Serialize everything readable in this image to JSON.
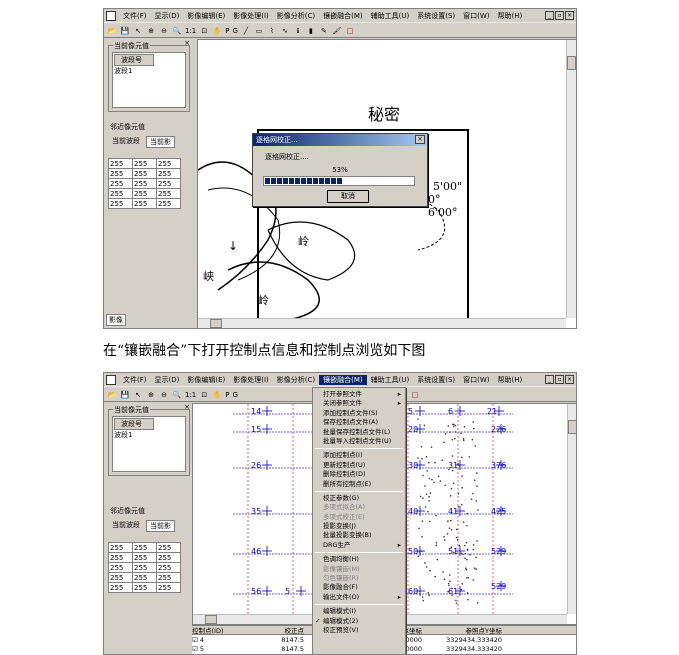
{
  "screenshot1": {
    "menu": [
      "文件(F)",
      "显示(D)",
      "影像编辑(E)",
      "影像处理(I)",
      "影像分析(C)",
      "镶嵌融合(M)",
      "辅助工具(U)",
      "系统设置(S)",
      "窗口(W)",
      "帮助(H)"
    ],
    "toolbar_text": [
      "1:1",
      "P",
      "G"
    ],
    "panel": {
      "group1_title": "当前像元值",
      "list_header": "波段号",
      "list_items": [
        "波段1"
      ],
      "group2_title": "邻近像元值",
      "tab_label1": "当前波段",
      "tab_label2": "当前影",
      "grid": [
        [
          "255",
          "255",
          "255"
        ],
        [
          "255",
          "255",
          "255"
        ],
        [
          "255",
          "255",
          "255"
        ],
        [
          "255",
          "255",
          "255"
        ],
        [
          "255",
          "255",
          "255"
        ]
      ]
    },
    "map": {
      "secret_label": "秘密",
      "coord_text": [
        "5'00\"",
        "0°",
        "6'00°"
      ],
      "place_labels": [
        "峡",
        "岭",
        "岭",
        "↓"
      ]
    },
    "dialog": {
      "title": "逐格网校正...",
      "close": "×",
      "message": "逐格网校正....",
      "percent_text": "53%",
      "progress": 53,
      "cancel": "取消"
    },
    "status_tab": "影像"
  },
  "caption": "在“镶嵌融合”下打开控制点信息和控制点浏览如下图",
  "screenshot2": {
    "menu": [
      "文件(F)",
      "显示(D)",
      "影像编辑(E)",
      "影像处理(I)",
      "影像分析(C)",
      "镶嵌融合(M)",
      "辅助工具(U)",
      "系统设置(S)",
      "窗口(W)",
      "帮助(H)"
    ],
    "panel": {
      "group1_title": "当前像元值",
      "list_header": "波段号",
      "list_items": [
        "波段1"
      ],
      "group2_title": "邻近像元值",
      "tab_label1": "当前波段",
      "tab_label2": "当前影",
      "grid": [
        [
          "255",
          "255",
          "255"
        ],
        [
          "255",
          "255",
          "255"
        ],
        [
          "255",
          "255",
          "255"
        ],
        [
          "255",
          "255",
          "255"
        ],
        [
          "255",
          "255",
          "255"
        ]
      ]
    },
    "dropdown": [
      {
        "label": "打开参照文件",
        "arrow": true
      },
      {
        "label": "关闭参照文件",
        "arrow": true
      },
      {
        "label": "添加控制点文件(S)"
      },
      {
        "label": "保存控制点文件(A)"
      },
      {
        "label": "批量保存控制点文件(L)"
      },
      {
        "label": "批量导入控制点文件(U)"
      },
      {
        "sep": true
      },
      {
        "label": "添加控制点(I)"
      },
      {
        "label": "更新控制点(U)"
      },
      {
        "label": "删除控制点(D)"
      },
      {
        "label": "删所有控制点(E)"
      },
      {
        "sep": true
      },
      {
        "label": "校正参数(G)"
      },
      {
        "label": "多项式拟合(A)",
        "disabled": true
      },
      {
        "label": "多项式校正(E)",
        "disabled": true
      },
      {
        "label": "投影变换(J)"
      },
      {
        "label": "批量投影变换(B)"
      },
      {
        "label": "DRG生产",
        "arrow": true
      },
      {
        "sep": true
      },
      {
        "label": "色调均衡(H)"
      },
      {
        "label": "影像镶嵌(M)",
        "disabled": true
      },
      {
        "label": "匀色镶嵌(R)",
        "disabled": true
      },
      {
        "label": "影像融合(F)"
      },
      {
        "label": "输出文件(O)",
        "arrow": true
      },
      {
        "sep": true
      },
      {
        "label": "编辑模式(I)"
      },
      {
        "label": "编辑模式(2)",
        "checked": true
      },
      {
        "label": "校正预览(V)"
      }
    ],
    "grid_labels_left": [
      "14",
      "15",
      "26",
      "35",
      "46",
      "56",
      "5"
    ],
    "grid_labels_right": [
      "5",
      "6",
      "21",
      "20",
      "30",
      "31",
      "40",
      "41",
      "50",
      "51",
      "60",
      "61"
    ],
    "grid_labels_far": [
      "226",
      "376",
      "425",
      "529",
      "529"
    ],
    "table": {
      "headers": [
        "控制点(ID)",
        "校正点",
        "参照点X坐标",
        "参照点Y坐标"
      ],
      "rows": [
        [
          "4",
          "8147.5",
          "523000.000000",
          "3329434.333420"
        ],
        [
          "5",
          "8147.5",
          "523000.000000",
          "3329434.333420"
        ]
      ]
    }
  }
}
